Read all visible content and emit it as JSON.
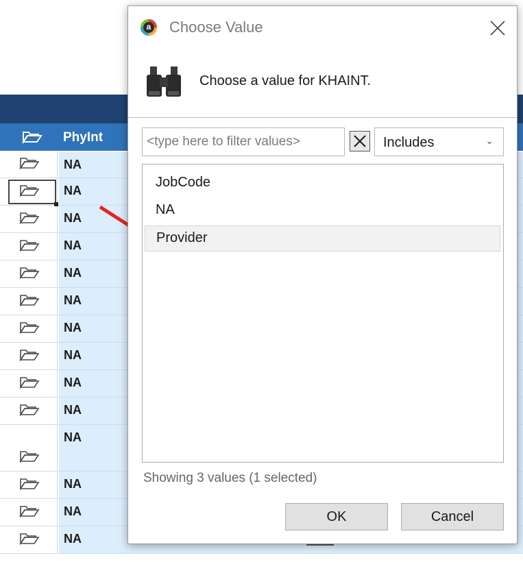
{
  "background_grid": {
    "header": {
      "column_label": "PhyInt",
      "header_icon": "open-folder-icon"
    },
    "row_icon": "folder-icon",
    "rows": [
      {
        "value": "NA"
      },
      {
        "value": "NA"
      },
      {
        "value": "NA"
      },
      {
        "value": "NA"
      },
      {
        "value": "NA"
      },
      {
        "value": "NA"
      },
      {
        "value": "NA"
      },
      {
        "value": "NA"
      },
      {
        "value": "NA"
      },
      {
        "value": "NA"
      },
      {
        "value": "NA"
      },
      {
        "value": "NA"
      },
      {
        "value": "NA"
      },
      {
        "value": "NA"
      }
    ],
    "colors": {
      "top_band": "#1f4270",
      "header": "#2f73bb",
      "cell_bg": "#dcedfb"
    }
  },
  "dialog": {
    "title": "Choose Value",
    "app_icon": "a",
    "close_icon": "close-icon",
    "prompt": "Choose a value for KHAINT.",
    "prompt_icon": "binoculars-icon",
    "filter": {
      "placeholder": "<type here to filter values>",
      "value": "",
      "clear_icon": "clear-x-icon"
    },
    "match_mode": {
      "selected": "Includes",
      "chevron_icon": "chevron-down-icon"
    },
    "values": [
      {
        "label": "JobCode",
        "selected": false
      },
      {
        "label": "NA",
        "selected": false
      },
      {
        "label": "Provider",
        "selected": true
      }
    ],
    "status": "Showing 3 values (1 selected)",
    "buttons": {
      "ok": "OK",
      "cancel": "Cancel"
    }
  },
  "annotation": {
    "arrow_color": "#e5261f"
  }
}
